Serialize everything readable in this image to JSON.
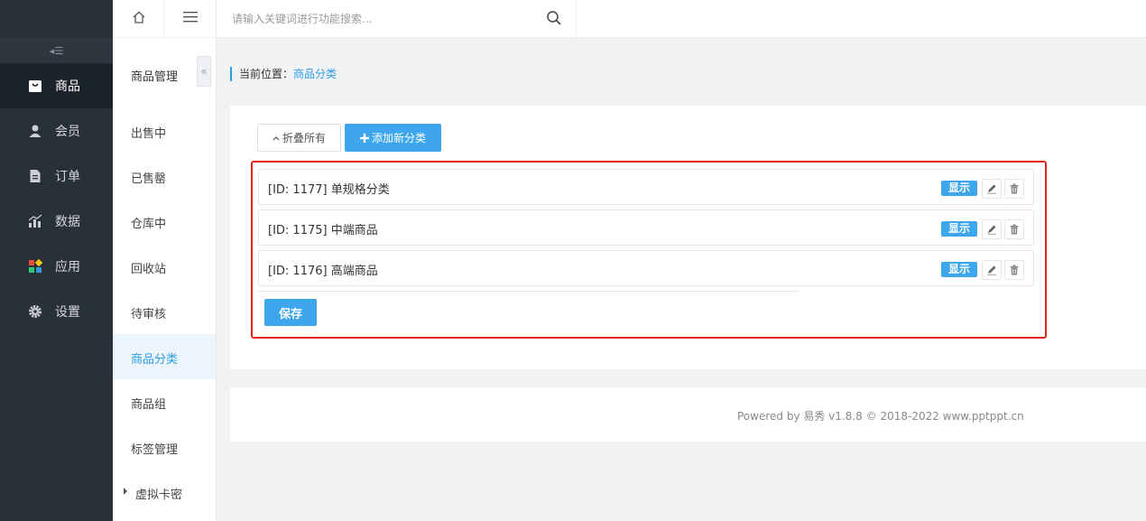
{
  "main_nav": {
    "items": [
      {
        "label": "商品",
        "icon": "shopping-bag-icon",
        "active": true
      },
      {
        "label": "会员",
        "icon": "user-icon",
        "active": false
      },
      {
        "label": "订单",
        "icon": "document-icon",
        "active": false
      },
      {
        "label": "数据",
        "icon": "bar-chart-icon",
        "active": false
      },
      {
        "label": "应用",
        "icon": "apps-grid-icon",
        "active": false
      },
      {
        "label": "设置",
        "icon": "gear-icon",
        "active": false
      }
    ],
    "collapse_symbol": "◂☰"
  },
  "sub_nav": {
    "title": "商品管理",
    "toggle_symbol": "«",
    "items": [
      {
        "label": "出售中"
      },
      {
        "label": "已售罄"
      },
      {
        "label": "仓库中"
      },
      {
        "label": "回收站"
      },
      {
        "label": "待审核"
      },
      {
        "label": "商品分类",
        "active": true
      },
      {
        "label": "商品组"
      },
      {
        "label": "标签管理"
      },
      {
        "label": "虚拟卡密"
      }
    ]
  },
  "topbar": {
    "search_placeholder": "请输入关键词进行功能搜索..."
  },
  "breadcrumb": {
    "prefix": "当前位置：",
    "current": "商品分类"
  },
  "toolbar": {
    "collapse_label": "折叠所有",
    "add_label": "添加新分类"
  },
  "categories": [
    {
      "text": "[ID: 1177] 单规格分类",
      "status": "显示"
    },
    {
      "text": "[ID: 1175] 中端商品",
      "status": "显示"
    },
    {
      "text": "[ID: 1176] 高端商品",
      "status": "显示"
    }
  ],
  "save_label": "保存",
  "footer": {
    "text": "Powered by 易秀 v1.8.8 © 2018-2022 www.pptppt.cn"
  },
  "colors": {
    "accent": "#3ea6ec",
    "sidebar_dark": "#293038",
    "highlight_border": "#e2231a"
  }
}
